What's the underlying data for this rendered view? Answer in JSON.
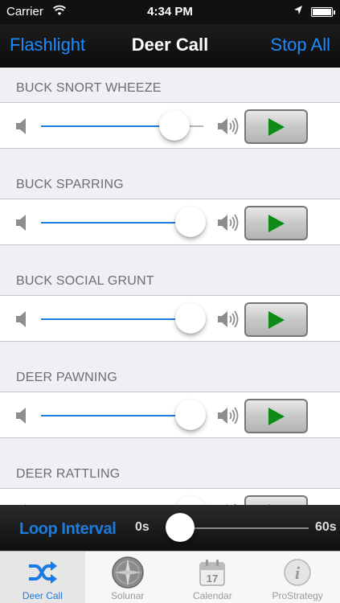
{
  "status": {
    "carrier": "Carrier",
    "time": "4:34 PM"
  },
  "nav": {
    "left": "Flashlight",
    "title": "Deer Call",
    "right": "Stop All"
  },
  "calls": [
    {
      "name": "BUCK SNORT WHEEZE",
      "volume": 0.82
    },
    {
      "name": "BUCK SPARRING",
      "volume": 0.92
    },
    {
      "name": "BUCK SOCIAL GRUNT",
      "volume": 0.92
    },
    {
      "name": "DEER PAWNING",
      "volume": 0.92
    },
    {
      "name": "DEER RATTLING",
      "volume": 0.92
    }
  ],
  "loop": {
    "label": "Loop Interval",
    "min": "0s",
    "max": "60s",
    "value": 0
  },
  "tabs": [
    {
      "label": "Deer Call",
      "icon": "shuffle-icon",
      "active": true
    },
    {
      "label": "Solunar",
      "icon": "compass-icon",
      "active": false
    },
    {
      "label": "Calendar",
      "icon": "calendar-icon",
      "active": false,
      "icon_text": "17"
    },
    {
      "label": "ProStrategy",
      "icon": "info-icon",
      "active": false,
      "icon_text": "i"
    }
  ],
  "colors": {
    "accent": "#1a7be0",
    "play": "#0d8a17"
  }
}
